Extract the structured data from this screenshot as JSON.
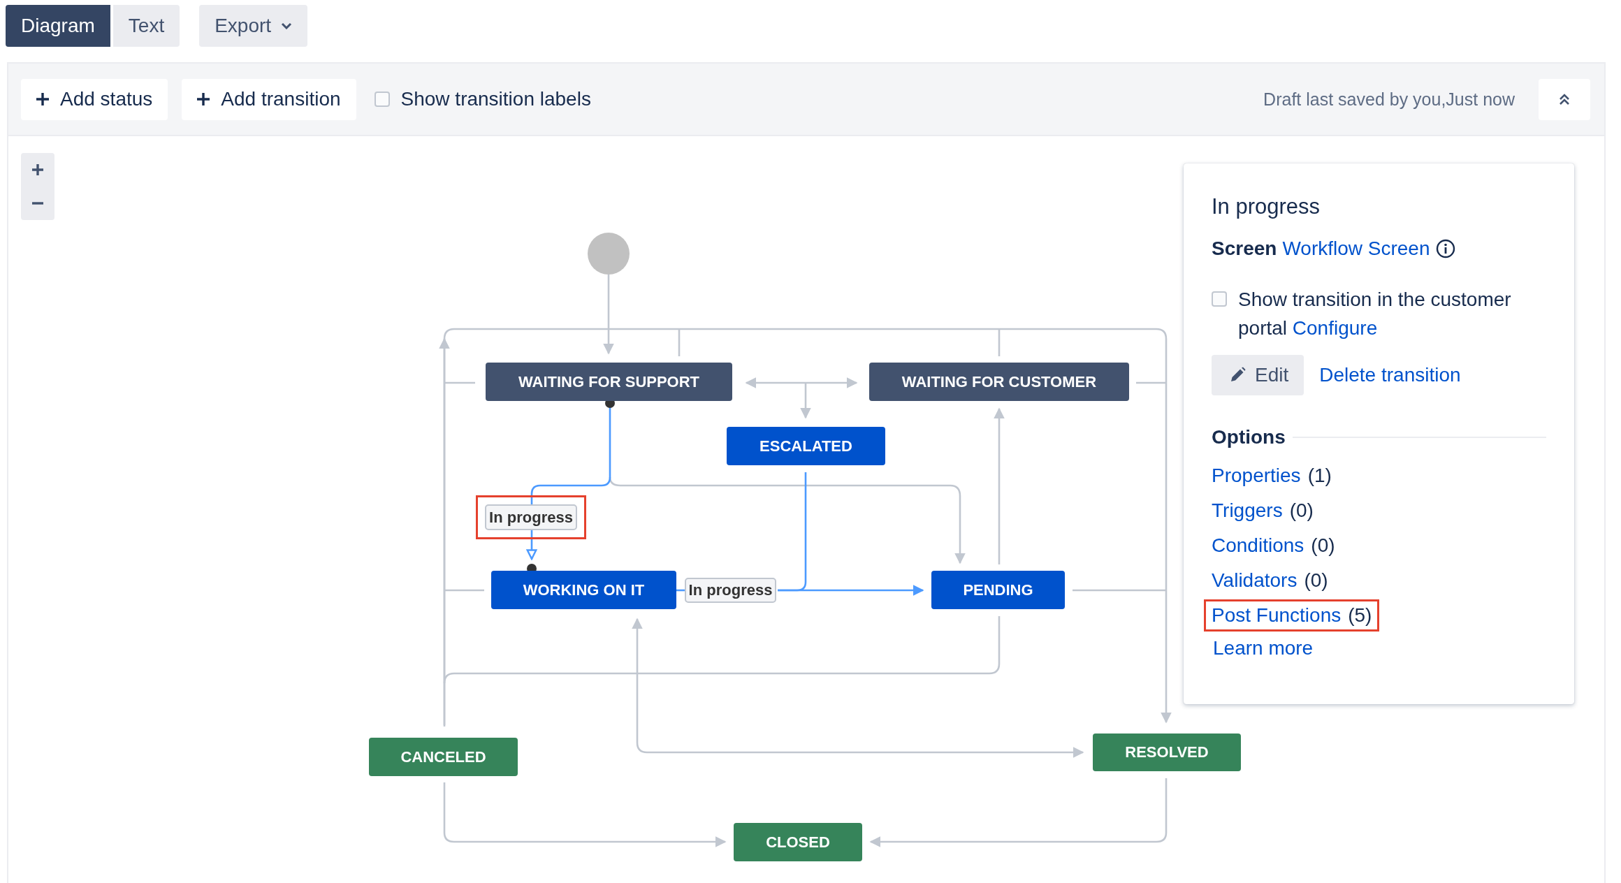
{
  "view_tabs": [
    {
      "label": "Diagram",
      "selected": true
    },
    {
      "label": "Text",
      "selected": false
    }
  ],
  "export_menu": {
    "label": "Export"
  },
  "toolbar": {
    "add_status": "Add status",
    "add_transition": "Add transition",
    "show_labels": {
      "label": "Show transition labels",
      "checked": false
    },
    "draft_status": "Draft last saved by you,Just now"
  },
  "diagram": {
    "statuses": [
      {
        "name": "WAITING FOR SUPPORT",
        "color": "#42526e"
      },
      {
        "name": "WAITING FOR CUSTOMER",
        "color": "#42526e"
      },
      {
        "name": "ESCALATED",
        "color": "#0052cc"
      },
      {
        "name": "WORKING ON IT",
        "color": "#0052cc"
      },
      {
        "name": "PENDING",
        "color": "#0052cc"
      },
      {
        "name": "CANCELED",
        "color": "#36845a"
      },
      {
        "name": "RESOLVED",
        "color": "#36845a"
      },
      {
        "name": "CLOSED",
        "color": "#36845a"
      }
    ],
    "transition_labels": [
      {
        "text": "In progress",
        "highlighted": true
      },
      {
        "text": "In progress",
        "highlighted": false
      }
    ]
  },
  "panel": {
    "title": "In progress",
    "screen_label": "Screen",
    "screen_link": "Workflow Screen",
    "portal": {
      "text": "Show transition in the customer portal",
      "link": "Configure",
      "checked": false
    },
    "edit_button": "Edit",
    "delete_link": "Delete transition",
    "options_heading": "Options",
    "options": [
      {
        "link": "Properties",
        "count": "(1)",
        "highlighted": false
      },
      {
        "link": "Triggers",
        "count": "(0)",
        "highlighted": false
      },
      {
        "link": "Conditions",
        "count": "(0)",
        "highlighted": false
      },
      {
        "link": "Validators",
        "count": "(0)",
        "highlighted": false
      },
      {
        "link": "Post Functions",
        "count": "(5)",
        "highlighted": true
      }
    ],
    "learn_more": "Learn more"
  }
}
